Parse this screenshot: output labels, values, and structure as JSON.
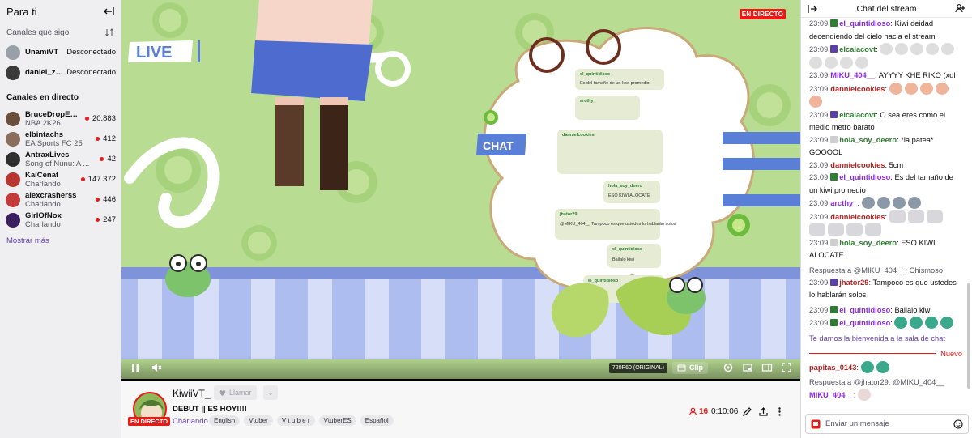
{
  "sidebar": {
    "title": "Para ti",
    "followed_header": "Canales que sigo",
    "followed": [
      {
        "name": "UnamiVT",
        "status": "Desconectado",
        "avatar_color": "#9aa0a8"
      },
      {
        "name": "daniel_zo...",
        "status": "Desconectado",
        "avatar_color": "#3a3a3a"
      }
    ],
    "live_header": "Canales en directo",
    "live": [
      {
        "name": "BruceDropEmOff",
        "game": "NBA 2K26",
        "viewers": "20.883",
        "avatar_color": "#6b4f3a"
      },
      {
        "name": "elbintachs",
        "game": "EA Sports FC 25",
        "viewers": "412",
        "avatar_color": "#8a6d5b"
      },
      {
        "name": "AntraxLives",
        "game": "Song of Nunu: A ...",
        "viewers": "42",
        "avatar_color": "#2f2f2f"
      },
      {
        "name": "KaiCenat",
        "game": "Charlando",
        "viewers": "147.372",
        "avatar_color": "#b8362f"
      },
      {
        "name": "alexcrasherss",
        "game": "Charlando",
        "viewers": "446",
        "avatar_color": "#c23a3a"
      },
      {
        "name": "GirlOfNox",
        "game": "Charlando",
        "viewers": "247",
        "avatar_color": "#3b1f5e"
      }
    ],
    "show_more": "Mostrar más"
  },
  "video": {
    "live_badge": "EN DIRECTO",
    "overlay_live": "LIVE",
    "overlay_chat": "CHAT",
    "quality": "720P60 (ORIGINAL)",
    "clip_label": "Clip",
    "overlay_chat_msgs": [
      {
        "user": "el_quintidioso",
        "text": "Es del tamaño de un kiwi promedio"
      },
      {
        "user": "arcthy_",
        "text": ""
      },
      {
        "user": "dannielcookies",
        "text": ""
      },
      {
        "user": "hola_soy_deero",
        "text": "ESO KIWI ALOCATE"
      },
      {
        "user": "jhator29",
        "text": "@MIKU_404__ Tampoco es que ustedes lo hablarán solos"
      },
      {
        "user": "el_quintidioso",
        "text": "Bailalo kiwi"
      },
      {
        "user": "el_quintidioso",
        "text": ""
      }
    ]
  },
  "info": {
    "streamer": "KiwiiVT_",
    "call_label": "Llamar",
    "live_pill": "EN DIRECTO",
    "title": "DEBUT || ES HOY!!!!",
    "category": "Charlando",
    "tags": [
      "English",
      "Vtuber",
      "V t u b e r",
      "VtuberES",
      "Español"
    ],
    "viewers": "16",
    "uptime": "0:10:06"
  },
  "chat": {
    "title": "Chat del stream",
    "messages": [
      {
        "time": "23:09",
        "user": "el_quintidioso",
        "color": "#8a2be2",
        "text": "Kiwi deidad decendiendo del cielo hacia el stream"
      },
      {
        "time": "23:09",
        "user": "elcalacovt",
        "color": "#2e7d32",
        "text": ""
      },
      {
        "time": "23:09",
        "user": "MIKU_404__",
        "color": "#8a2be2",
        "text": "AYYYY KHE RIKO (xdl"
      },
      {
        "time": "23:09",
        "user": "dannielcookies",
        "color": "#b22222",
        "text": ""
      },
      {
        "time": "23:09",
        "user": "elcalacovt",
        "color": "#2e7d32",
        "text": "O sea eres como el medio metro barato"
      },
      {
        "time": "23:09",
        "user": "hola_soy_deero",
        "color": "#2e7d32",
        "text": "*la patea* GOOOOL"
      },
      {
        "time": "23:09",
        "user": "dannielcookies",
        "color": "#b22222",
        "text": "5cm"
      },
      {
        "time": "23:09",
        "user": "el_quintidioso",
        "color": "#8a2be2",
        "text": "Es del tamaño de un kiwi promedio"
      },
      {
        "time": "23:09",
        "user": "arcthy_",
        "color": "#8a2be2",
        "text": ""
      },
      {
        "time": "23:09",
        "user": "dannielcookies",
        "color": "#b22222",
        "text": ""
      },
      {
        "time": "23:09",
        "user": "hola_soy_deero",
        "color": "#2e7d32",
        "text": "ESO KIWI ALOCATE"
      },
      {
        "time": "23:09",
        "user": "jhator29",
        "color": "#b22222",
        "text": "Tampoco es que ustedes lo hablarán solos",
        "reply": "Respuesta a @MIKU_404__: Chismoso"
      },
      {
        "time": "23:09",
        "user": "el_quintidioso",
        "color": "#8a2be2",
        "text": "Bailalo kiwi"
      },
      {
        "time": "23:09",
        "user": "el_quintidioso",
        "color": "#8a2be2",
        "text": ""
      }
    ],
    "welcome": "Te damos la bienvenida a la sala de chat",
    "new_label": "Nuevo",
    "after": [
      {
        "user": "papitas_0143",
        "color": "#b22222",
        "text": ""
      },
      {
        "user": "MIKU_404__",
        "color": "#8a2be2",
        "text": "",
        "reply": "Respuesta a @jhator29: @MIKU_404__"
      }
    ],
    "input_placeholder": "Enviar un mensaje"
  }
}
